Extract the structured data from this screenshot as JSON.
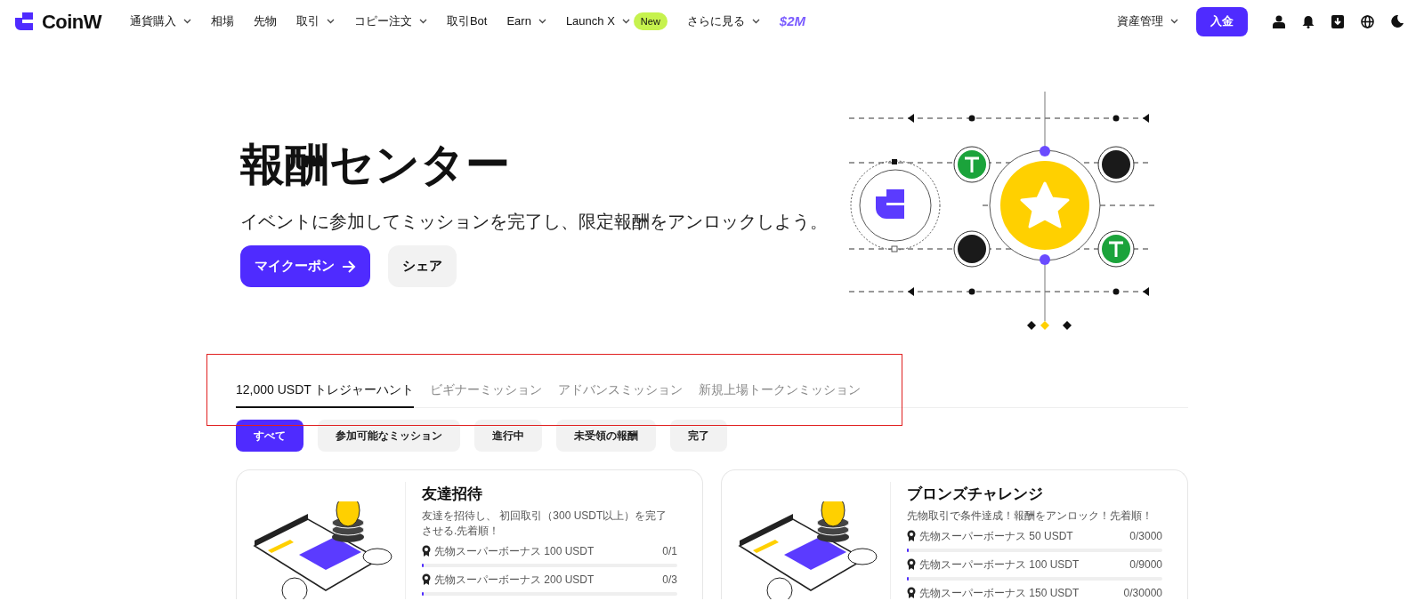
{
  "nav": {
    "logo": "CoinW",
    "items": [
      {
        "label": "通貨購入",
        "dropdown": true
      },
      {
        "label": "相場",
        "dropdown": false
      },
      {
        "label": "先物",
        "dropdown": false
      },
      {
        "label": "取引",
        "dropdown": true
      },
      {
        "label": "コピー注文",
        "dropdown": true
      },
      {
        "label": "取引Bot",
        "dropdown": false
      },
      {
        "label": "Earn",
        "dropdown": true
      },
      {
        "label": "Launch X",
        "dropdown": true,
        "badge": "New"
      },
      {
        "label": "さらに見る",
        "dropdown": true
      }
    ],
    "promo": "$2M",
    "asset_menu": "資産管理",
    "deposit_button": "入金"
  },
  "hero": {
    "title": "報酬センター",
    "subtitle": "イベントに参加してミッションを完了し、限定報酬をアンロックしよう。",
    "primary_button": "マイクーポン",
    "secondary_button": "シェア"
  },
  "tabs": [
    {
      "label": "12,000 USDT トレジャーハント",
      "selected": true
    },
    {
      "label": "ビギナーミッション",
      "selected": false
    },
    {
      "label": "アドバンスミッション",
      "selected": false
    },
    {
      "label": "新規上場トークンミッション",
      "selected": false
    }
  ],
  "filters": [
    {
      "label": "すべて",
      "selected": true
    },
    {
      "label": "参加可能なミッション",
      "selected": false
    },
    {
      "label": "進行中",
      "selected": false
    },
    {
      "label": "未受領の報酬",
      "selected": false
    },
    {
      "label": "完了",
      "selected": false
    }
  ],
  "missions": [
    {
      "title": "友達招待",
      "description": "友達を招待し、 初回取引（300 USDT以上）を完了させる.先着順！",
      "rewards": [
        {
          "label": "先物スーパーボーナス 100 USDT",
          "progress": "0/1",
          "level": 0
        },
        {
          "label": "先物スーパーボーナス 200 USDT",
          "progress": "0/3",
          "level": 0
        }
      ]
    },
    {
      "title": "ブロンズチャレンジ",
      "description": "先物取引で条件達成！報酬をアンロック！先着順！",
      "rewards": [
        {
          "label": "先物スーパーボーナス 50 USDT",
          "progress": "0/3000",
          "level": 0
        },
        {
          "label": "先物スーパーボーナス 100 USDT",
          "progress": "0/9000",
          "level": 0
        },
        {
          "label": "先物スーパーボーナス 150 USDT",
          "progress": "0/30000"
        }
      ]
    }
  ]
}
